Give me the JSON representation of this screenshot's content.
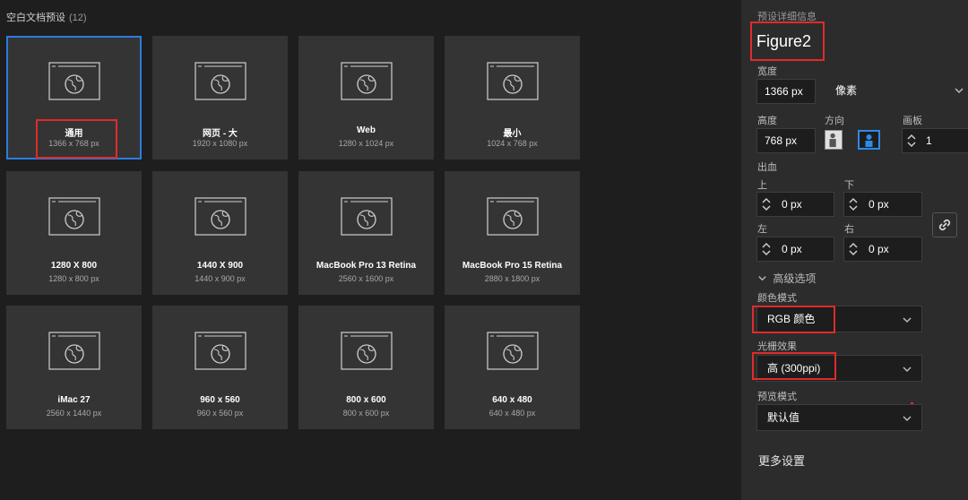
{
  "presets": {
    "title": "空白文档预设",
    "count": "(12)",
    "items": [
      {
        "name": "通用",
        "size": "1366 x 768 px",
        "selected": true
      },
      {
        "name": "网页 - 大",
        "size": "1920 x 1080 px"
      },
      {
        "name": "Web",
        "size": "1280 x 1024 px"
      },
      {
        "name": "最小",
        "size": "1024 x 768 px"
      },
      {
        "name": "1280 X 800",
        "size": "1280 x 800 px"
      },
      {
        "name": "1440 X 900",
        "size": "1440 x 900 px"
      },
      {
        "name": "MacBook Pro 13 Retina",
        "size": "2560 x 1600 px"
      },
      {
        "name": "MacBook Pro 15 Retina",
        "size": "2880 x 1800 px"
      },
      {
        "name": "iMac 27",
        "size": "2560 x 1440 px"
      },
      {
        "name": "960 x 560",
        "size": "960 x 560 px"
      },
      {
        "name": "800 x 600",
        "size": "800 x 600 px"
      },
      {
        "name": "640 x 480",
        "size": "640 x 480 px"
      }
    ]
  },
  "details": {
    "header": "预设详细信息",
    "preset_name": "Figure2",
    "width_label": "宽度",
    "width_value": "1366 px",
    "unit_value": "像素",
    "height_label": "高度",
    "height_value": "768 px",
    "orientation_label": "方向",
    "artboard_label": "画板",
    "artboard_value": "1",
    "bleed_label": "出血",
    "top_label": "上",
    "bottom_label": "下",
    "left_label": "左",
    "right_label": "右",
    "bleed_top": "0 px",
    "bleed_bottom": "0 px",
    "bleed_left": "0 px",
    "bleed_right": "0 px",
    "advanced_label": "高级选项",
    "color_mode_label": "颜色模式",
    "color_mode_value": "RGB 颜色",
    "raster_label": "光栅效果",
    "raster_value": "高 (300ppi)",
    "preview_label": "预览模式",
    "preview_value": "默认值",
    "more_settings": "更多设置"
  },
  "colors": {
    "accent_blue": "#2b7ce0",
    "highlight_red": "#e02b2b"
  }
}
